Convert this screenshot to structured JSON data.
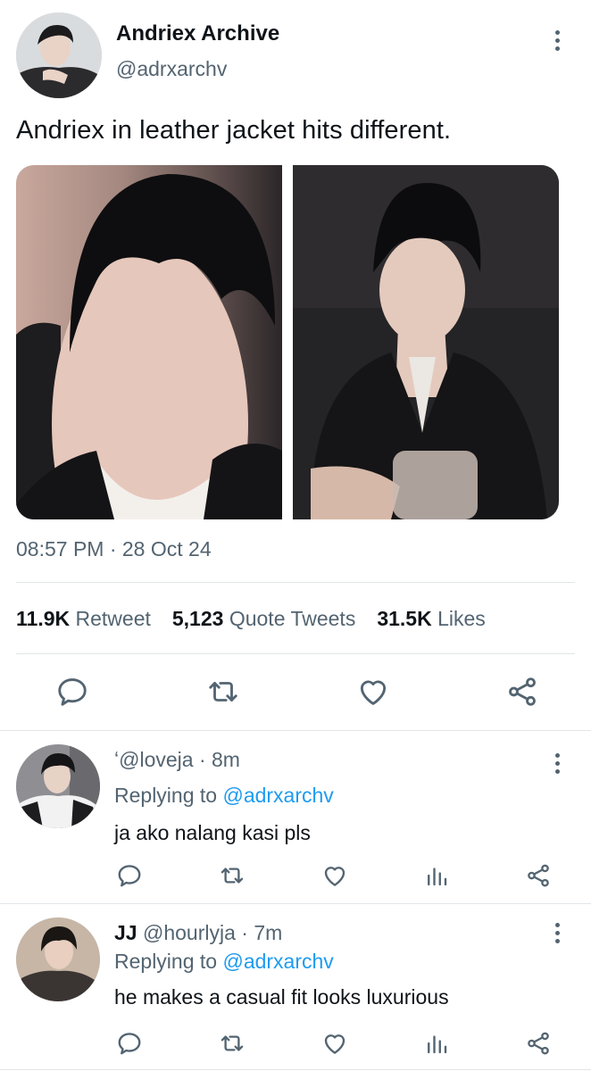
{
  "tweet": {
    "display_name": "Andriex Archive",
    "handle": "@adrxarchv",
    "text": "Andriex in leather jacket hits different.",
    "timestamp": "08:57 PM · 28 Oct 24",
    "stats": {
      "retweets_count": "11.9K",
      "retweets_label": "Retweet",
      "quotes_count": "5,123",
      "quotes_label": "Quote Tweets",
      "likes_count": "31.5K",
      "likes_label": "Likes"
    },
    "actions": [
      "reply-icon",
      "retweet-icon",
      "like-icon",
      "share-icon"
    ]
  },
  "replies": [
    {
      "display_name": "",
      "handle_meta": "ʻ@loveja · 8m",
      "replying_prefix": "Replying to ",
      "replying_to": "@adrxarchv",
      "text": "ja ako nalang kasi pls"
    },
    {
      "display_name": "JJ",
      "handle_meta": "@hourlyja · 7m",
      "replying_prefix": "Replying to ",
      "replying_to": "@adrxarchv",
      "text": "he makes a casual fit looks luxurious"
    }
  ],
  "colors": {
    "text_primary": "#0f1419",
    "text_secondary": "#536471",
    "link": "#1d9bf0",
    "divider": "#e1e5e8"
  }
}
